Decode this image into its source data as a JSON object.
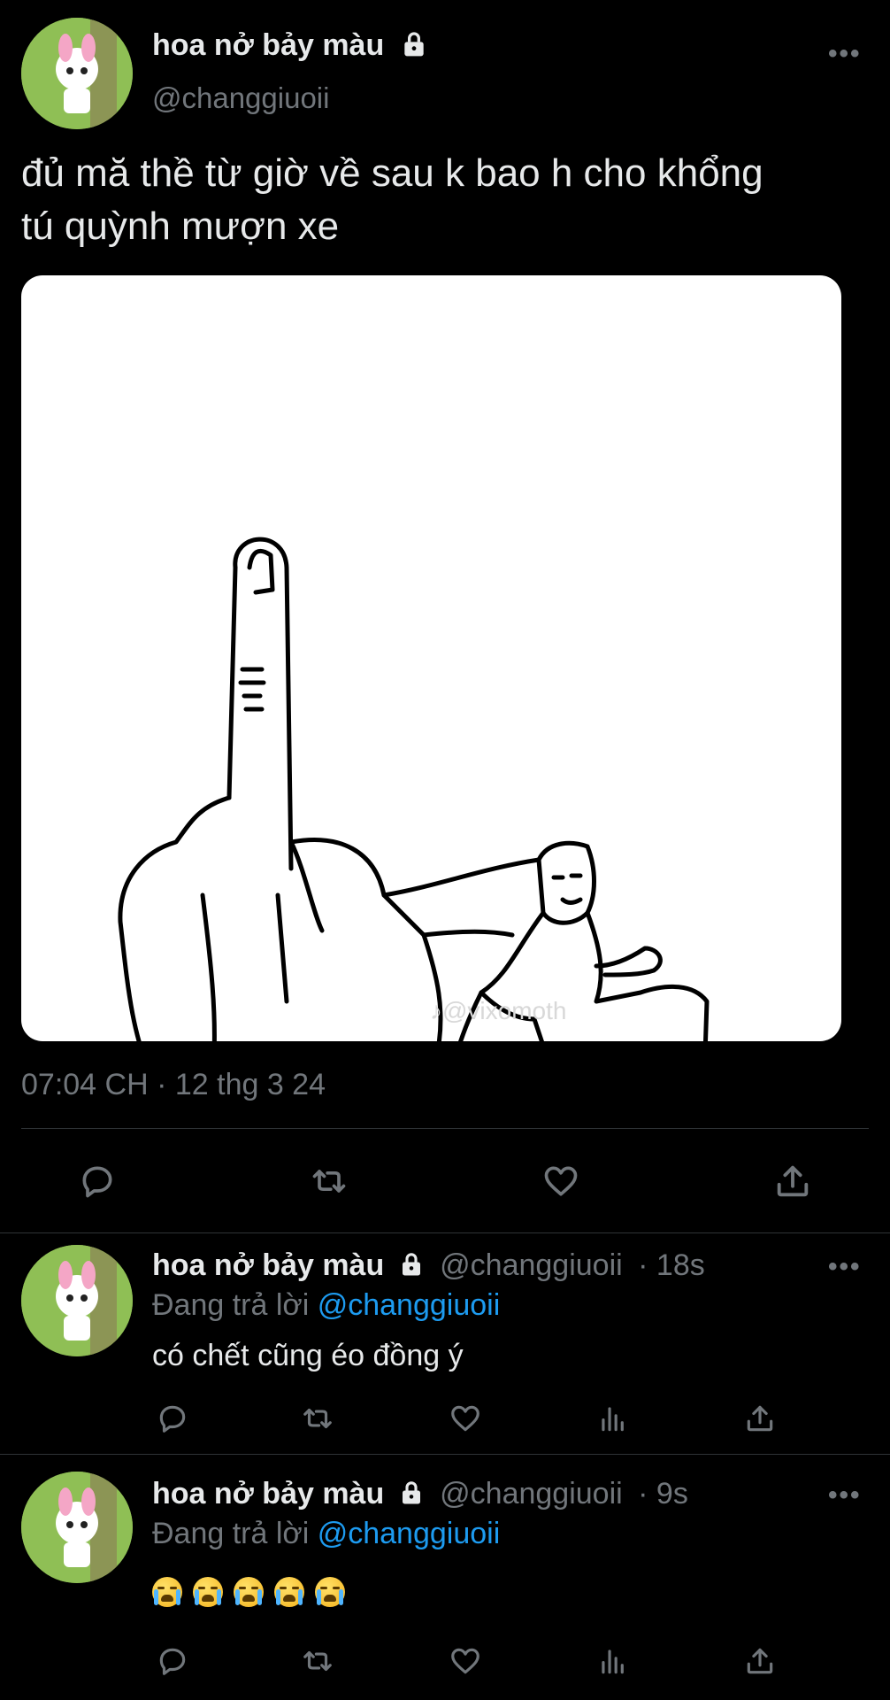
{
  "main_tweet": {
    "display_name": "hoa nở bảy màu",
    "handle": "@changgiuoii",
    "text_line1": "đủ mă thề từ giờ về sau k bao h cho khổng",
    "text_line2": "tú quỳnh mượn xe",
    "watermark": "♪@vixomoth",
    "timestamp": "07:04 CH · 12 thg 3 24"
  },
  "replies": [
    {
      "display_name": "hoa nở bảy màu",
      "handle": "@changgiuoii",
      "time": "· 18s",
      "replying_prefix": "Đang trả lời",
      "replying_to": "@changgiuoii",
      "text": "có chết cũng éo đồng ý"
    },
    {
      "display_name": "hoa nở bảy màu",
      "handle": "@changgiuoii",
      "time": "· 9s",
      "replying_prefix": "Đang trả lời",
      "replying_to": "@changgiuoii",
      "emoji_count": 5,
      "emoji": "loudly-crying-face"
    }
  ],
  "icons": {
    "more": "more-horizontal-icon",
    "lock": "lock-icon",
    "reply": "reply-icon",
    "retweet": "retweet-icon",
    "like": "heart-icon",
    "views": "views-chart-icon",
    "share": "share-icon"
  },
  "colors": {
    "background": "#000000",
    "text": "#e7e9ea",
    "muted": "#71767b",
    "link": "#1d9bf0",
    "divider": "#2f3336"
  },
  "more_label": "•••"
}
